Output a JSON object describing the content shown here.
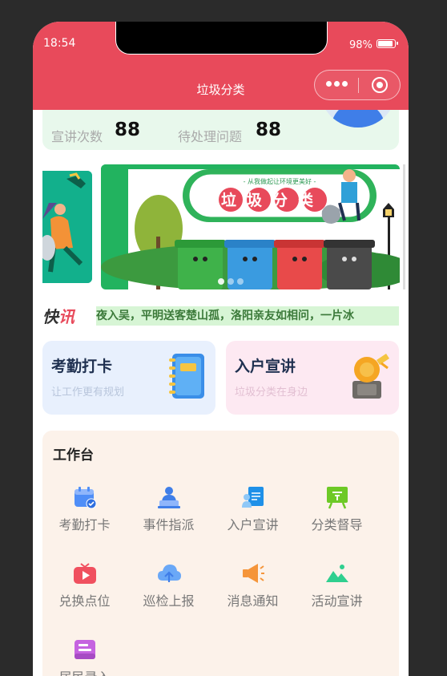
{
  "status_bar": {
    "time": "18:54",
    "battery": "98%",
    "battery_level": 0.98
  },
  "nav": {
    "title": "垃圾分类"
  },
  "stats": {
    "talks_label": "宣讲次数",
    "talks_value": "88",
    "pending_label": "待处理问题",
    "pending_value": "88"
  },
  "banner": {
    "slogan": "- 从我做起让环境更美好 -",
    "title": "垃圾分类"
  },
  "news": {
    "tag_main": "快",
    "tag_accent": "讯",
    "text": "夜入吴，平明送客楚山孤，洛阳亲友如相问，一片冰"
  },
  "cards": [
    {
      "title": "考勤打卡",
      "subtitle": "让工作更有规划",
      "bg": "#e8f0fd",
      "sub_color": "#b9c6dc"
    },
    {
      "title": "入户宣讲",
      "subtitle": "垃圾分类在身边",
      "bg": "#fde9f2",
      "sub_color": "#e2bfd2"
    }
  ],
  "workbench": {
    "title": "工作台",
    "tools": [
      {
        "label": "考勤打卡",
        "icon": "calendar-check-icon",
        "color": "#4f8ef7"
      },
      {
        "label": "事件指派",
        "icon": "person-laptop-icon",
        "color": "#3f7ee8"
      },
      {
        "label": "入户宣讲",
        "icon": "presenter-icon",
        "color": "#1e90e8"
      },
      {
        "label": "分类督导",
        "icon": "easel-icon",
        "color": "#6dc926"
      },
      {
        "label": "兑换点位",
        "icon": "tv-play-icon",
        "color": "#f0505f"
      },
      {
        "label": "巡检上报",
        "icon": "cloud-upload-icon",
        "color": "#6aa8f7"
      },
      {
        "label": "消息通知",
        "icon": "megaphone-icon",
        "color": "#f5953a"
      },
      {
        "label": "活动宣讲",
        "icon": "mountain-image-icon",
        "color": "#2fcf8f"
      },
      {
        "label": "居民录入",
        "icon": "resident-form-icon",
        "color": "#c563e0"
      }
    ]
  }
}
